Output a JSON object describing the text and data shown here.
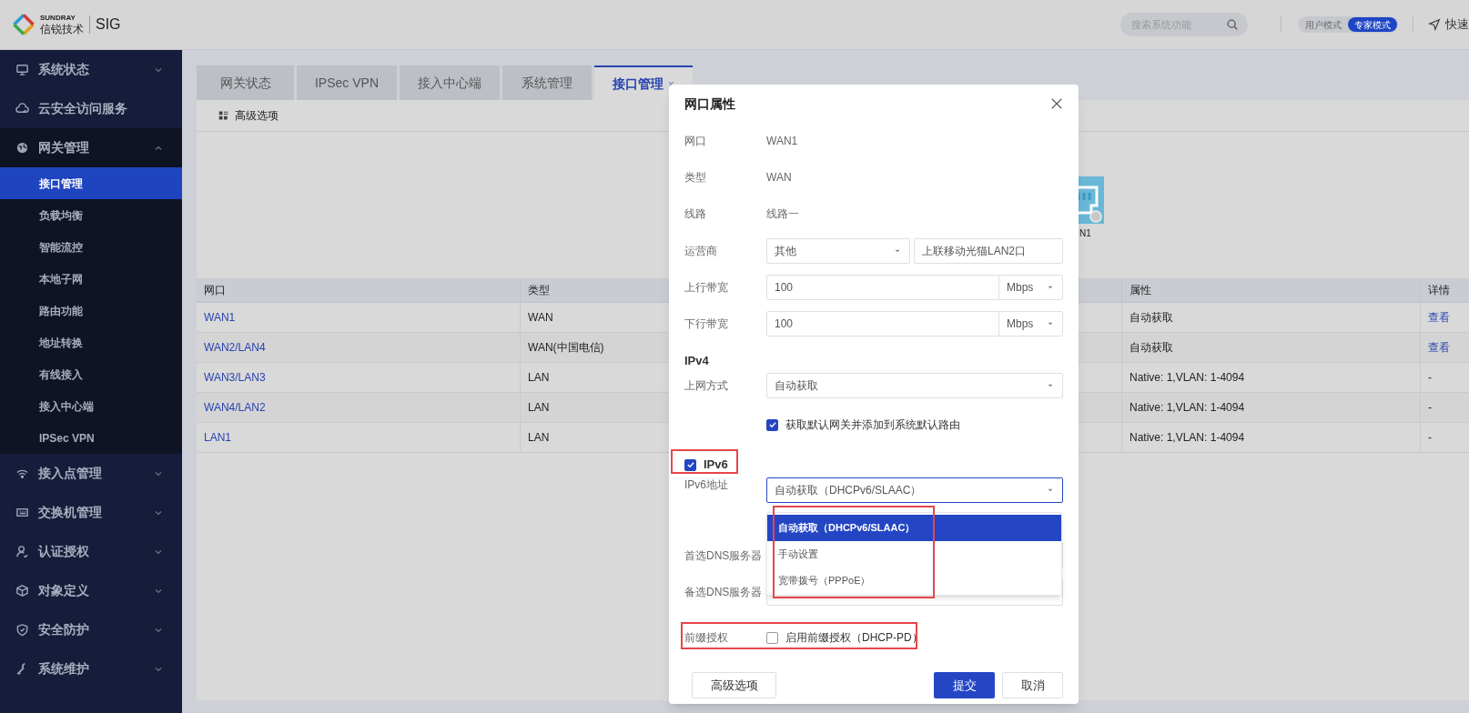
{
  "header": {
    "logo_small": "SUNDRAY",
    "logo_text": "信锐技术",
    "product": "SIG",
    "search": {
      "placeholder": "搜索系统功能"
    },
    "modes": [
      {
        "label": "用户模式",
        "selected": false
      },
      {
        "label": "专家模式",
        "selected": true
      }
    ],
    "quick_link": "快速"
  },
  "sidebar": {
    "items": [
      {
        "label": "系统状态",
        "expanded": false
      },
      {
        "label": "云安全访问服务"
      },
      {
        "label": "网关管理",
        "expanded": true,
        "children": [
          {
            "label": "接口管理",
            "selected": true
          },
          {
            "label": "负载均衡",
            "selected": false
          },
          {
            "label": "智能流控",
            "selected": false
          },
          {
            "label": "本地子网",
            "selected": false
          },
          {
            "label": "路由功能",
            "selected": false
          },
          {
            "label": "地址转换",
            "selected": false
          },
          {
            "label": "有线接入",
            "selected": false
          },
          {
            "label": "接入中心端",
            "selected": false
          },
          {
            "label": "IPSec VPN",
            "selected": false
          }
        ]
      },
      {
        "label": "接入点管理",
        "expanded": false
      },
      {
        "label": "交换机管理",
        "expanded": false
      },
      {
        "label": "认证授权",
        "expanded": false
      },
      {
        "label": "对象定义",
        "expanded": false
      },
      {
        "label": "安全防护",
        "expanded": false
      },
      {
        "label": "系统维护",
        "expanded": false
      }
    ]
  },
  "tabs": [
    {
      "label": "网关状态",
      "selected": false,
      "closable": false
    },
    {
      "label": "IPSec VPN",
      "selected": false,
      "closable": false
    },
    {
      "label": "接入中心端",
      "selected": false,
      "closable": false
    },
    {
      "label": "系统管理",
      "selected": false,
      "closable": false
    },
    {
      "label": "接口管理",
      "selected": true,
      "closable": true
    }
  ],
  "toolbar": {
    "advanced": "高级选项"
  },
  "device": {
    "label": "N1"
  },
  "table": {
    "columns": [
      "网口",
      "类型",
      "属性",
      "详情"
    ],
    "rows": [
      {
        "port": "WAN1",
        "type": "WAN",
        "attribute": "自动获取",
        "detail": "查看",
        "detail_link": true
      },
      {
        "port": "WAN2/LAN4",
        "type": "WAN(中国电信)",
        "attribute": "自动获取",
        "detail": "查看",
        "detail_link": true
      },
      {
        "port": "WAN3/LAN3",
        "type": "LAN",
        "attribute": "Native: 1,VLAN: 1-4094",
        "detail": "-",
        "detail_link": false
      },
      {
        "port": "WAN4/LAN2",
        "type": "LAN",
        "attribute": "Native: 1,VLAN: 1-4094",
        "detail": "-",
        "detail_link": false
      },
      {
        "port": "LAN1",
        "type": "LAN",
        "attribute": "Native: 1,VLAN: 1-4094",
        "detail": "-",
        "detail_link": false
      }
    ]
  },
  "dialog": {
    "title": "网口属性",
    "info": [
      {
        "label": "网口",
        "value": "WAN1"
      },
      {
        "label": "类型",
        "value": "WAN"
      },
      {
        "label": "线路",
        "value": "线路一"
      }
    ],
    "carrier": {
      "label": "运营商",
      "select": "其他",
      "note": "上联移动光猫LAN2口"
    },
    "bandwidth": [
      {
        "label": "上行带宽",
        "value": "100",
        "unit": "Mbps"
      },
      {
        "label": "下行带宽",
        "value": "100",
        "unit": "Mbps"
      }
    ],
    "ipv4": {
      "heading": "IPv4",
      "mode_label": "上网方式",
      "mode": "自动获取",
      "gateway_option": {
        "label": "获取默认网关并添加到系统默认路由",
        "checked": true
      }
    },
    "ipv6": {
      "label": "IPv6",
      "checked": true,
      "highlighted": true,
      "address_label": "IPv6地址",
      "address": "自动获取（DHCPv6/SLAAC）",
      "dropdown": {
        "highlighted": true,
        "options": [
          {
            "label": "自动获取（DHCPv6/SLAAC）",
            "selected": true
          },
          {
            "label": "手动设置",
            "selected": false
          },
          {
            "label": "宽带拨号（PPPoE）",
            "selected": false
          }
        ]
      }
    },
    "dns": [
      {
        "label": "首选DNS服务器"
      },
      {
        "label": "备选DNS服务器"
      }
    ],
    "prefix": {
      "label": "前缀授权",
      "option": "启用前缀授权（DHCP-PD）",
      "checked": false,
      "highlighted": true
    },
    "buttons": {
      "advanced": "高级选项",
      "submit": "提交",
      "cancel": "取消"
    }
  }
}
